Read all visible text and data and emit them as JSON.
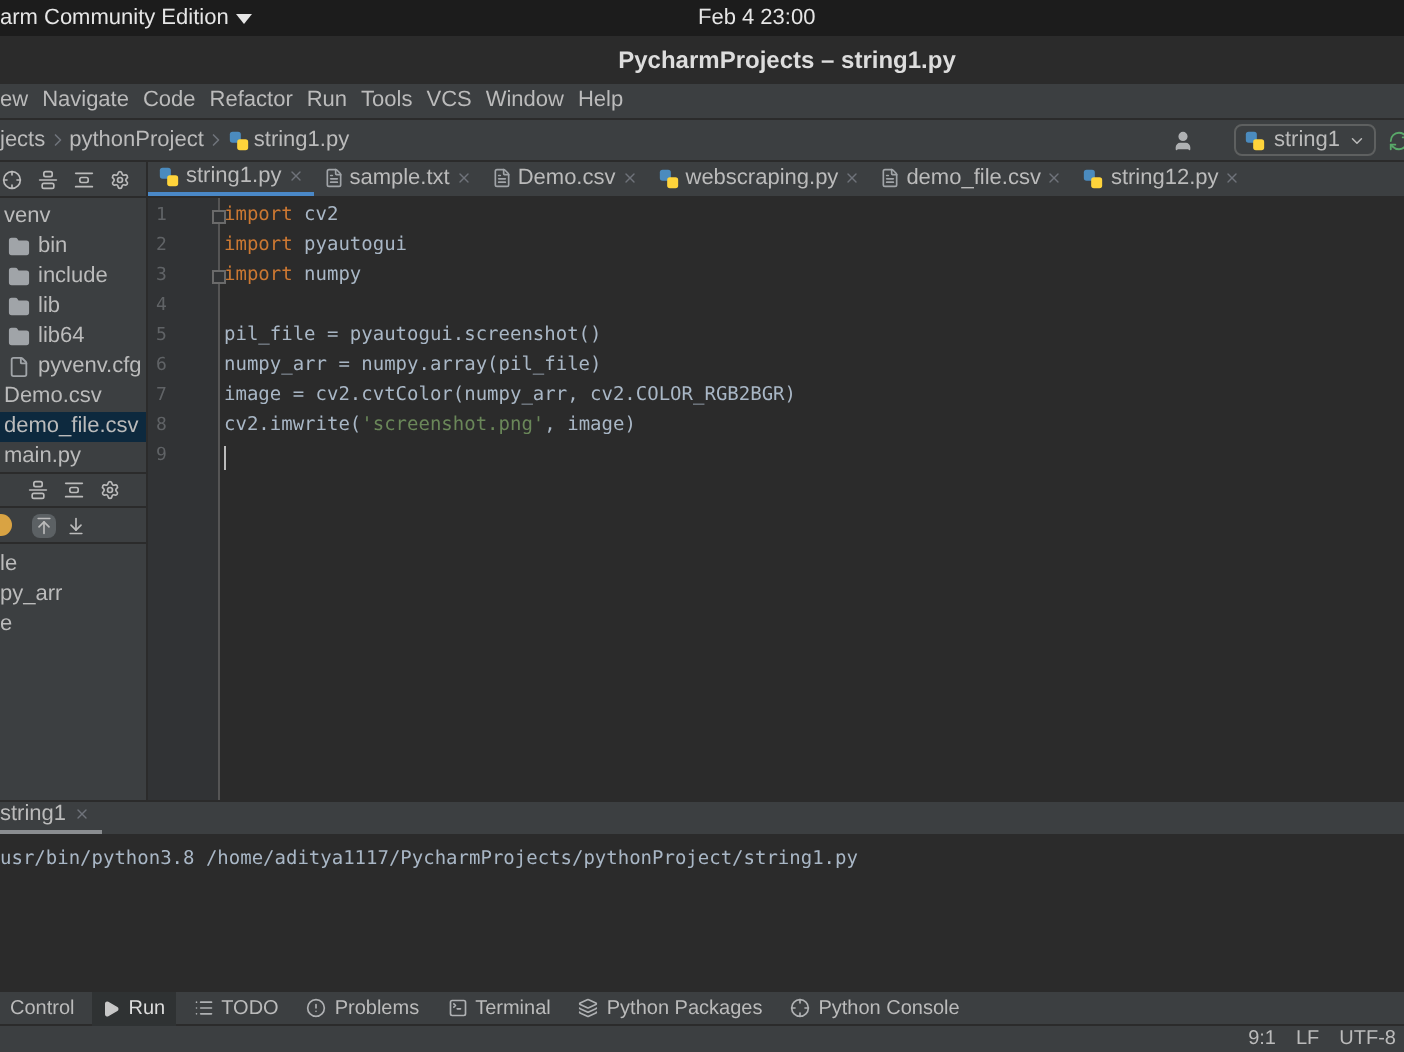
{
  "system_bar": {
    "app_menu": "arm Community Edition",
    "clock": "Feb 4  23:00"
  },
  "window": {
    "title": "PycharmProjects – string1.py"
  },
  "menu": [
    "ew",
    "Navigate",
    "Code",
    "Refactor",
    "Run",
    "Tools",
    "VCS",
    "Window",
    "Help"
  ],
  "breadcrumbs": [
    {
      "label": "jects"
    },
    {
      "label": "pythonProject"
    },
    {
      "label": "string1.py",
      "kind": "python"
    }
  ],
  "run_config": "string1",
  "project_tree": [
    {
      "label": "venv",
      "selected": false,
      "children": [
        {
          "label": "bin",
          "kind": "folder",
          "selected": false
        },
        {
          "label": "include",
          "kind": "folder",
          "selected": false
        },
        {
          "label": "lib",
          "kind": "folder",
          "selected": false
        },
        {
          "label": "lib64",
          "kind": "folder",
          "selected": false
        },
        {
          "label": "pyvenv.cfg",
          "kind": "file",
          "selected": false
        }
      ]
    },
    {
      "label": "Demo.csv",
      "selected": false
    },
    {
      "label": "demo_file.csv",
      "selected": true
    },
    {
      "label": "main.py",
      "selected": false
    }
  ],
  "structure": [
    "le",
    "py_arr",
    "e"
  ],
  "editor_tabs": [
    {
      "label": "string1.py",
      "kind": "python",
      "selected": true
    },
    {
      "label": "sample.txt",
      "kind": "text",
      "selected": false
    },
    {
      "label": "Demo.csv",
      "kind": "text",
      "selected": false
    },
    {
      "label": "webscraping.py",
      "kind": "python",
      "selected": false
    },
    {
      "label": "demo_file.csv",
      "kind": "text",
      "selected": false
    },
    {
      "label": "string12.py",
      "kind": "python",
      "selected": false
    }
  ],
  "code": [
    {
      "number": "1",
      "fold": true,
      "caret": false,
      "tokens": [
        {
          "text": "import",
          "kind": "keyword"
        },
        {
          "text": " cv2",
          "kind": "plain"
        }
      ]
    },
    {
      "number": "2",
      "fold": false,
      "caret": false,
      "tokens": [
        {
          "text": "import",
          "kind": "keyword"
        },
        {
          "text": " pyautogui",
          "kind": "plain"
        }
      ]
    },
    {
      "number": "3",
      "fold": true,
      "caret": false,
      "tokens": [
        {
          "text": "import",
          "kind": "keyword"
        },
        {
          "text": " numpy",
          "kind": "plain"
        }
      ]
    },
    {
      "number": "4",
      "fold": false,
      "caret": false
    },
    {
      "number": "5",
      "fold": false,
      "caret": false,
      "tokens": [
        {
          "text": "pil_file = pyautogui.screenshot()",
          "kind": "plain"
        }
      ]
    },
    {
      "number": "6",
      "fold": false,
      "caret": false,
      "tokens": [
        {
          "text": "numpy_arr = numpy.array(pil_file)",
          "kind": "plain"
        }
      ]
    },
    {
      "number": "7",
      "fold": false,
      "caret": false,
      "tokens": [
        {
          "text": "image = cv2.cvtColor(numpy_arr, cv2.COLOR_RGB2BGR)",
          "kind": "plain"
        }
      ]
    },
    {
      "number": "8",
      "fold": false,
      "caret": false,
      "tokens": [
        {
          "text": "cv2.imwrite(",
          "kind": "plain"
        },
        {
          "text": "'screenshot.png'",
          "kind": "string"
        },
        {
          "text": ", image)",
          "kind": "plain"
        }
      ]
    },
    {
      "number": "9",
      "fold": false,
      "caret": true
    }
  ],
  "run_panel": {
    "tab": "string1",
    "output": "usr/bin/python3.8 /home/aditya1117/PycharmProjects/pythonProject/string1.py"
  },
  "tool_tabs": [
    {
      "label": "Control",
      "selected": false
    },
    {
      "label": "Run",
      "kind": "run",
      "selected": true
    },
    {
      "label": "TODO",
      "kind": "list",
      "selected": false
    },
    {
      "label": "Problems",
      "kind": "alert",
      "selected": false
    },
    {
      "label": "Terminal",
      "kind": "terminal",
      "selected": false
    },
    {
      "label": "Python Packages",
      "kind": "layers",
      "selected": false
    },
    {
      "label": "Python Console",
      "kind": "python",
      "selected": false
    }
  ],
  "status": [
    "9:1",
    "LF",
    "UTF-8"
  ]
}
